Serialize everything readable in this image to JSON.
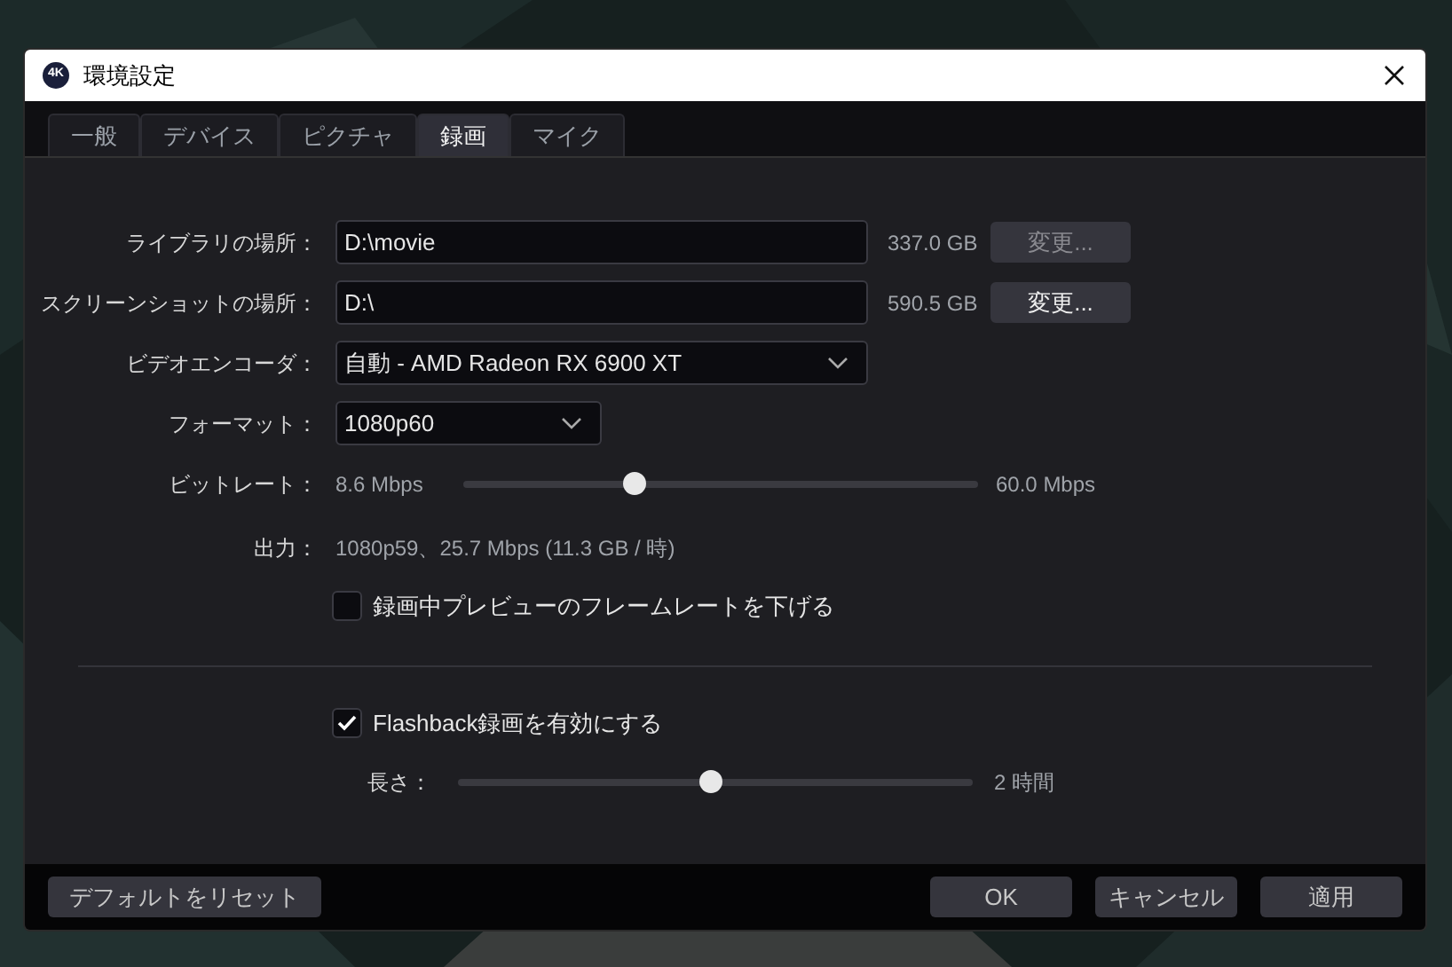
{
  "window": {
    "title": "環境設定",
    "app_icon": "4K"
  },
  "tabs": [
    {
      "label": "一般",
      "selected": false
    },
    {
      "label": "デバイス",
      "selected": false
    },
    {
      "label": "ピクチャ",
      "selected": false
    },
    {
      "label": "録画",
      "selected": true
    },
    {
      "label": "マイク",
      "selected": false
    }
  ],
  "paths": [
    {
      "label": "ライブラリの場所：",
      "value": "D:\\movie",
      "free": "337.0 GB",
      "button": "変更...",
      "disabled": true
    },
    {
      "label": "スクリーンショットの場所：",
      "value": "D:\\",
      "free": "590.5 GB",
      "button": "変更...",
      "disabled": false
    }
  ],
  "encoder": {
    "label": "ビデオエンコーダ：",
    "value": "自動 - AMD Radeon RX 6900 XT"
  },
  "format": {
    "label": "フォーマット：",
    "value": "1080p60"
  },
  "bitrate": {
    "label": "ビットレート：",
    "reading": "8.6 Mbps",
    "max": "60.0 Mbps",
    "level": 0.33
  },
  "output": {
    "label": "出力：",
    "value": "1080p59、25.7 Mbps (11.3 GB / 時)"
  },
  "lower_preview": {
    "label": "録画中プレビューのフレームレートを下げる",
    "checked": false
  },
  "flashback": {
    "label": "Flashback録画を有効にする",
    "checked": true
  },
  "length": {
    "label": "長さ：",
    "reading": "2 時間",
    "level": 0.49
  },
  "footer": {
    "reset": "デフォルトをリセット",
    "buttons": [
      "OK",
      "キャンセル",
      "適用"
    ]
  }
}
